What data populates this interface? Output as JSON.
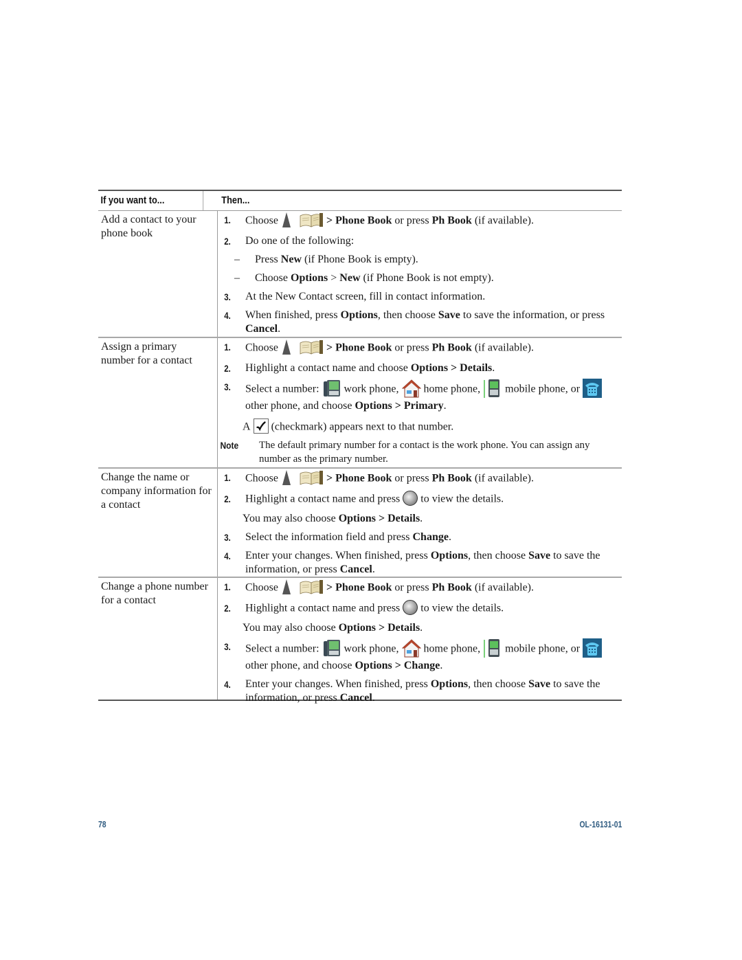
{
  "table": {
    "headers": {
      "col1": "If you want to...",
      "col2": "Then..."
    },
    "rows": [
      {
        "task": "Add a contact to your phone book",
        "step1": {
          "num": "1.",
          "pre": "Choose",
          "path1": "> Phone Book",
          "mid": " or press ",
          "key": "Ph Book",
          "post": " (if available)."
        },
        "step2": {
          "num": "2.",
          "text": "Do one of the following:"
        },
        "dash1": {
          "d": "–",
          "pre": "Press ",
          "b1": "New",
          "post": " (if Phone Book is empty)."
        },
        "dash2": {
          "d": "–",
          "pre": "Choose ",
          "b1": "Options",
          "mid": " > ",
          "b2": "New",
          "post": " (if Phone Book is not empty)."
        },
        "step3": {
          "num": "3.",
          "text": "At the New Contact screen, fill in contact information."
        },
        "step4": {
          "num": "4.",
          "pre": "When finished, press ",
          "b1": "Options",
          "mid": ", then choose ",
          "b2": "Save",
          "mid2": " to save the information, or press ",
          "b3": "Cancel",
          "post": "."
        }
      },
      {
        "task": "Assign a primary number for a contact",
        "step1": {
          "num": "1.",
          "pre": "Choose",
          "path1": "> Phone Book",
          "mid": " or press ",
          "key": "Ph Book",
          "post": " (if available)."
        },
        "step2": {
          "num": "2.",
          "pre": "Highlight a contact name and choose ",
          "b1": "Options > Details",
          "post": "."
        },
        "step3": {
          "num": "3.",
          "pre": "Select a number:",
          "work": "work phone,",
          "home": "home phone,",
          "mobile": "mobile phone, or",
          "other": "other phone, and choose ",
          "b1": "Options > Primary",
          "post": "."
        },
        "checkmark": {
          "pre": "A",
          "post": "(checkmark) appears next to that number."
        },
        "note": {
          "label": "Note",
          "text": "The default primary number for a contact is the work phone. You can assign any number as the primary number."
        }
      },
      {
        "task": "Change the name or company information for a contact",
        "step1": {
          "num": "1.",
          "pre": "Choose",
          "path1": "> Phone Book",
          "mid": " or press ",
          "key": "Ph Book",
          "post": " (if available)."
        },
        "step2": {
          "num": "2.",
          "pre": "Highlight a contact name and press",
          "post": "to view the details."
        },
        "also": {
          "pre": "You may also choose ",
          "b1": "Options > Details",
          "post": "."
        },
        "step3": {
          "num": "3.",
          "pre": "Select the information field and press ",
          "b1": "Change",
          "post": "."
        },
        "step4": {
          "num": "4.",
          "pre": "Enter your changes. When finished, press ",
          "b1": "Options",
          "mid": ", then choose ",
          "b2": "Save",
          "mid2": " to save the information, or press ",
          "b3": "Cancel",
          "post": "."
        }
      },
      {
        "task": "Change a phone number for a contact",
        "step1": {
          "num": "1.",
          "pre": "Choose",
          "path1": "> Phone Book",
          "mid": " or press ",
          "key": "Ph Book",
          "post": " (if available)."
        },
        "step2": {
          "num": "2.",
          "pre": "Highlight a contact name and press",
          "post": "to view the details."
        },
        "also": {
          "pre": "You may also choose ",
          "b1": "Options > Details",
          "post": "."
        },
        "step3": {
          "num": "3.",
          "pre": "Select a number:",
          "work": "work phone,",
          "home": "home phone,",
          "mobile": "mobile phone, or",
          "other": "other phone, and choose ",
          "b1": "Options > Change",
          "post": "."
        },
        "step4": {
          "num": "4.",
          "pre": "Enter your changes. When finished, press ",
          "b1": "Options",
          "mid": ", then choose ",
          "b2": "Save",
          "mid2": " to save the information, or press ",
          "b3": "Cancel",
          "post": "."
        }
      }
    ]
  },
  "icons": {
    "navigation": "navigation-up-arrow-icon",
    "phonebook": "phone-book-icon",
    "work": "work-phone-icon",
    "home": "home-phone-icon",
    "mobile": "mobile-phone-icon",
    "other": "other-phone-icon",
    "select": "select-button-icon",
    "checkmark": "checkmark-icon"
  },
  "colors": {
    "footer": "#2f5b80"
  },
  "footer": {
    "page_number": "78",
    "doc_id": "OL-16131-01"
  }
}
